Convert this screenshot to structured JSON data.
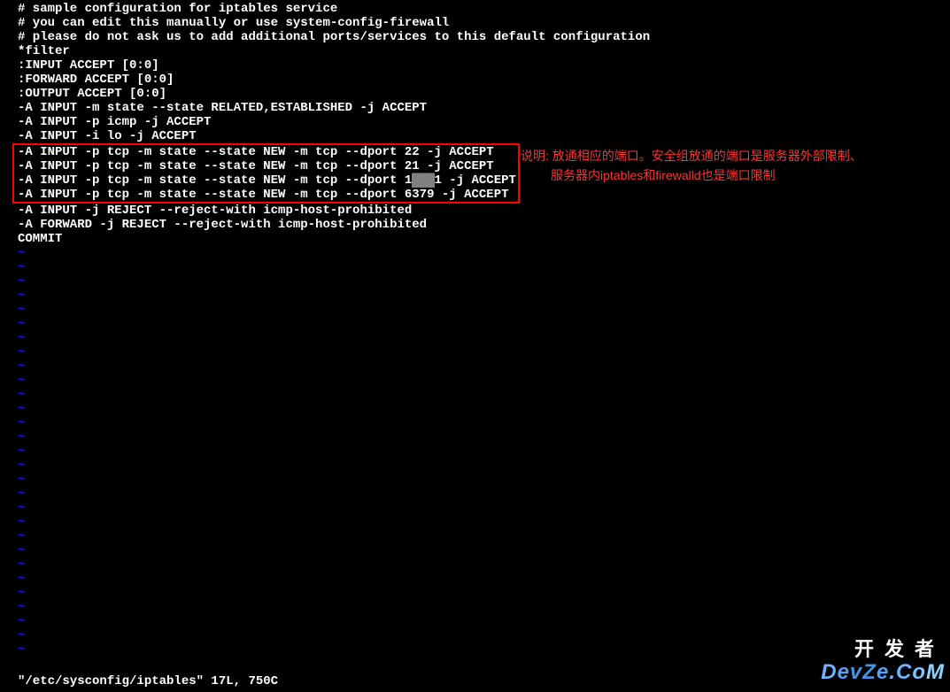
{
  "terminal": {
    "lines": [
      "# sample configuration for iptables service",
      "# you can edit this manually or use system-config-firewall",
      "# please do not ask us to add additional ports/services to this default configuration",
      "*filter",
      ":INPUT ACCEPT [0:0]",
      ":FORWARD ACCEPT [0:0]",
      ":OUTPUT ACCEPT [0:0]",
      "-A INPUT -m state --state RELATED,ESTABLISHED -j ACCEPT",
      "-A INPUT -p icmp -j ACCEPT",
      "-A INPUT -i lo -j ACCEPT"
    ],
    "highlighted": [
      "-A INPUT -p tcp -m state --state NEW -m tcp --dport 22 -j ACCEPT",
      "-A INPUT -p tcp -m state --state NEW -m tcp --dport 21 -j ACCEPT",
      "-A INPUT -p tcp -m state --state NEW -m tcp --dport 1███1 -j ACCEPT",
      "-A INPUT -p tcp -m state --state NEW -m tcp --dport 6379 -j ACCEPT"
    ],
    "lines_after": [
      "-A INPUT -j REJECT --reject-with icmp-host-prohibited",
      "-A FORWARD -j REJECT --reject-with icmp-host-prohibited",
      "COMMIT"
    ],
    "tilde": "~",
    "status": "\"/etc/sysconfig/iptables\" 17L, 750C"
  },
  "annotations": {
    "line1": "说明: 放通相应的端口。安全组放通的端口是服务器外部限制、",
    "line2": "服务器内iptables和firewalld也是端口限制"
  },
  "watermark": {
    "top": "开发者",
    "bottom_chars": {
      "d1": "D",
      "e1": "e",
      "v": "v",
      "z": "Z",
      "e2": "e",
      "dot": ".",
      "c": "C",
      "o": "o",
      "m": "M"
    }
  }
}
